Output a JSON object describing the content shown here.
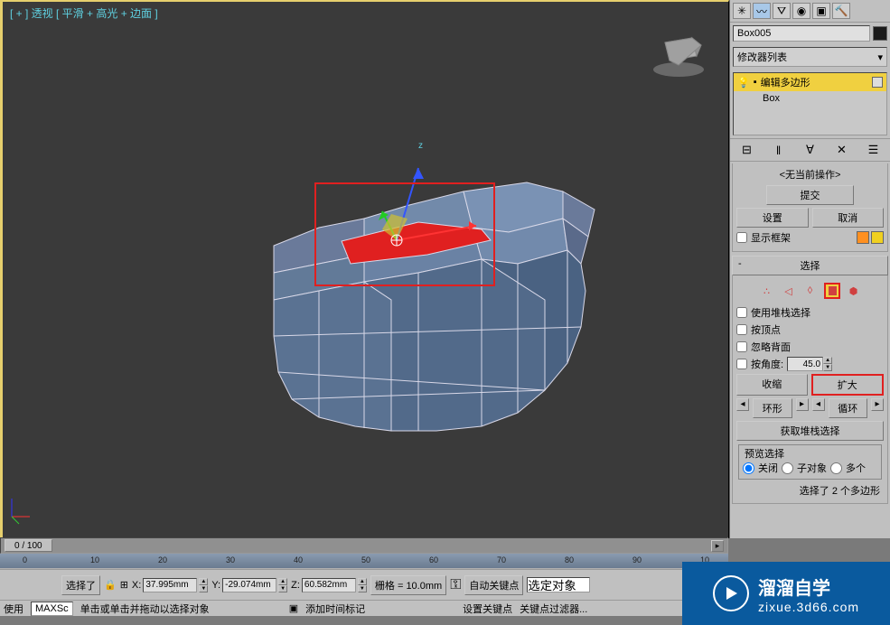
{
  "viewport": {
    "label": "[ + ] 透视 [ 平滑 + 高光 + 边面 ]"
  },
  "object_name": "Box005",
  "modifier_dropdown": "修改器列表",
  "modifier_stack": {
    "selected": "编辑多边形",
    "base": "Box"
  },
  "rollouts": {
    "no_current_op": {
      "title": "<无当前操作>",
      "commit": "提交",
      "settings": "设置",
      "cancel": "取消",
      "show_frame": "显示框架"
    },
    "selection": {
      "title": "选择",
      "use_stack_sel": "使用堆栈选择",
      "by_vertex": "按顶点",
      "ignore_backfacing": "忽略背面",
      "by_angle": "按角度:",
      "angle_value": "45.0",
      "shrink": "收缩",
      "grow": "扩大",
      "ring": "环形",
      "loop": "循环",
      "get_stack_sel": "获取堆栈选择",
      "preview_sel": "预览选择",
      "off": "关闭",
      "subobj": "子对象",
      "multi": "多个",
      "status": "选择了 2 个多边形"
    }
  },
  "timeline": {
    "scrubber": "0 / 100",
    "ticks": [
      "0",
      "10",
      "20",
      "30",
      "40",
      "50",
      "60",
      "70",
      "80",
      "90",
      "10"
    ]
  },
  "bottom": {
    "selected": "选择了",
    "x": "37.995mm",
    "y": "-29.074mm",
    "z": "60.582mm",
    "grid": "栅格 = 10.0mm",
    "autokey": "自动关键点",
    "selected_obj": "选定对象",
    "using": "使用",
    "maxsc": "MAXSc",
    "click_hint": "单击或单击并拖动以选择对象",
    "add_time_tag": "添加时间标记",
    "set_key": "设置关键点",
    "key_filter": "关键点过滤器..."
  },
  "chart_data": {
    "type": "3d_model",
    "object": "Box005",
    "modifier": "Edit Poly",
    "selected_faces": 2,
    "coords": {
      "x": 37.995,
      "y": -29.074,
      "z": 60.582
    },
    "units": "mm",
    "grid_spacing": 10.0,
    "frame_range": [
      0,
      100
    ],
    "current_frame": 0
  },
  "watermark": {
    "line1": "溜溜自学",
    "line2": "zixue.3d66.com"
  }
}
